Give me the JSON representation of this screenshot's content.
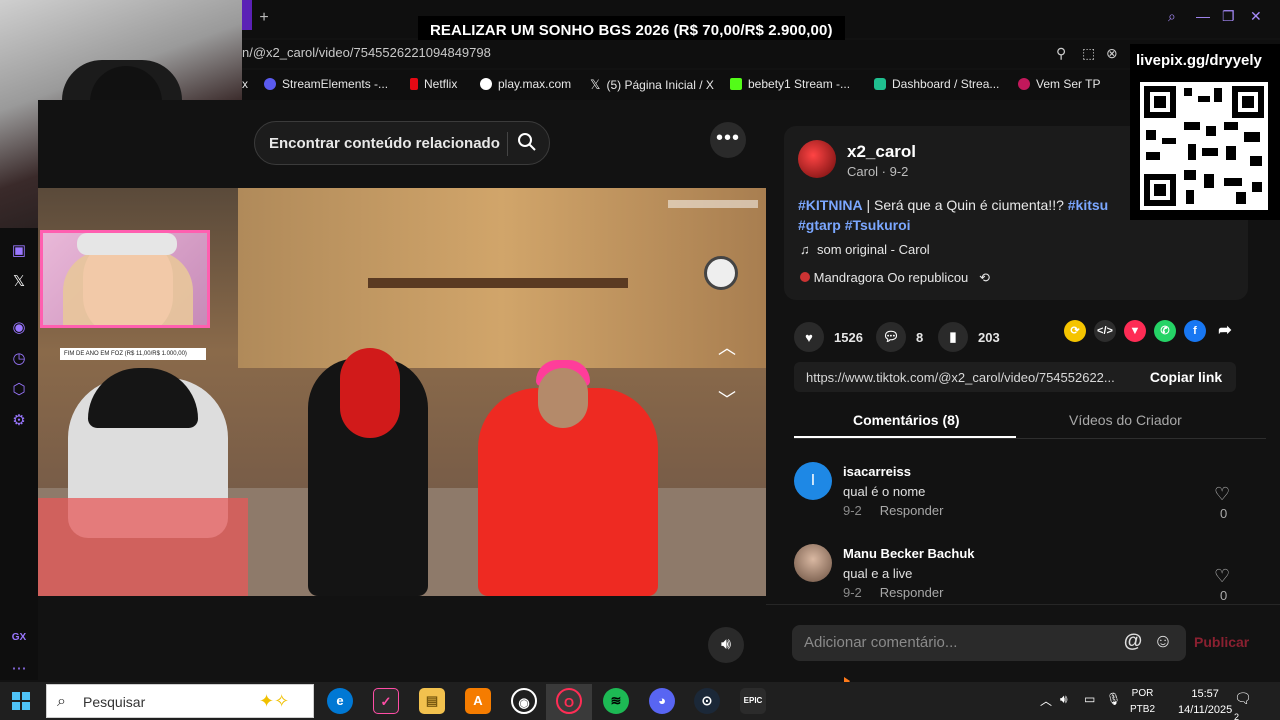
{
  "browser": {
    "new_tab_label": "+",
    "url": "n/@x2_carol/video/7545526221094849798",
    "bookmarks": [
      {
        "label": "x",
        "icon": "x-icon"
      },
      {
        "label": "StreamElements -...",
        "icon": "streamelements-icon"
      },
      {
        "label": "Netflix",
        "icon": "netflix-icon"
      },
      {
        "label": "play.max.com",
        "icon": "max-icon"
      },
      {
        "label": "(5) Página Inicial / X",
        "icon": "x-icon"
      },
      {
        "label": "bebety1 Stream -...",
        "icon": "kick-icon"
      },
      {
        "label": "Dashboard / Strea...",
        "icon": "dashboard-icon"
      },
      {
        "label": "Vem Ser TP",
        "icon": "tp-icon"
      }
    ]
  },
  "stream_overlay": {
    "donation_banner": "REALIZAR UM SONHO BGS 2026 (R$ 70,00/R$ 2.900,00)",
    "qr_label": "livepix.gg/dryyely",
    "cam_goal_text": "FIM DE ANO EM FOZ (R$ 11,00/R$ 1.000,00)"
  },
  "video_panel": {
    "search_label": "Encontrar conteúdo relacionado",
    "more_label": "•••"
  },
  "post": {
    "author": "x2_carol",
    "author_sub": "Carol · 9-2",
    "caption_tag1": "#KITNINA",
    "caption_text": " | Será que a Quin é ciumenta!!? ",
    "caption_tag2": "#kitsu",
    "caption_tag3": "#gtarp",
    "caption_tag4": "#Tsukuroi",
    "sound": "som original - Carol",
    "repost": "Mandragora Oo republicou"
  },
  "stats": {
    "likes": "1526",
    "comments": "8",
    "saves": "203"
  },
  "share": {
    "url": "https://www.tiktok.com/@x2_carol/video/754552622...",
    "copy_label": "Copiar link"
  },
  "tabs": {
    "comments": "Comentários (8)",
    "creator_videos": "Vídeos do Criador"
  },
  "comments": [
    {
      "name": "isacarreiss",
      "text": "qual é o nome",
      "date": "9-2",
      "reply": "Responder",
      "likes": "0",
      "avatar_letter": "I",
      "avatar_color": "#1e88e5"
    },
    {
      "name": "Manu Becker Bachuk",
      "text": "qual e a live",
      "date": "9-2",
      "reply": "Responder",
      "likes": "0",
      "avatar_letter": "",
      "avatar_color": "#a08070"
    }
  ],
  "comment_box": {
    "placeholder": "Adicionar comentário...",
    "at_label": "@",
    "publish_label": "Publicar"
  },
  "taskbar": {
    "search_placeholder": "Pesquisar",
    "lang": "POR",
    "lang2": "PTB2",
    "time": "15:57",
    "date": "14/11/2025",
    "notifications": "2"
  },
  "colors": {
    "accent_purple": "#9a77ff",
    "link_blue": "#7ba7ff",
    "publish_red": "#8a2030"
  }
}
